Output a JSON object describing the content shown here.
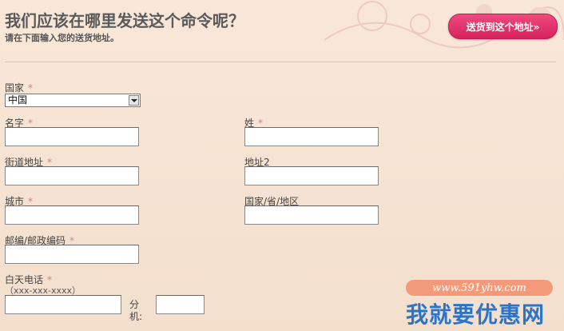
{
  "header": {
    "title": "我们应该在哪里发送这个命令呢？",
    "subtitle": "请在下面输入您的送货地址。",
    "ship_button_label": "送货到这个地址»"
  },
  "form": {
    "required_marker": "*",
    "country": {
      "label": "国家",
      "selected": "中国"
    },
    "first_name": {
      "label": "名字",
      "value": ""
    },
    "last_name": {
      "label": "姓",
      "value": ""
    },
    "street": {
      "label": "街道地址",
      "value": ""
    },
    "address2": {
      "label": "地址2",
      "value": ""
    },
    "city": {
      "label": "城市",
      "value": ""
    },
    "state": {
      "label": "国家/省/地区",
      "value": ""
    },
    "postcode": {
      "label": "邮编/邮政编码",
      "value": ""
    },
    "phone": {
      "label": "白天电话",
      "hint": "（xxx-xxx-xxxx）",
      "value": "",
      "ext_label": "分机:",
      "ext_value": ""
    }
  },
  "watermark": {
    "url": "www.591yhw.com",
    "text": "我就要优惠网"
  }
}
